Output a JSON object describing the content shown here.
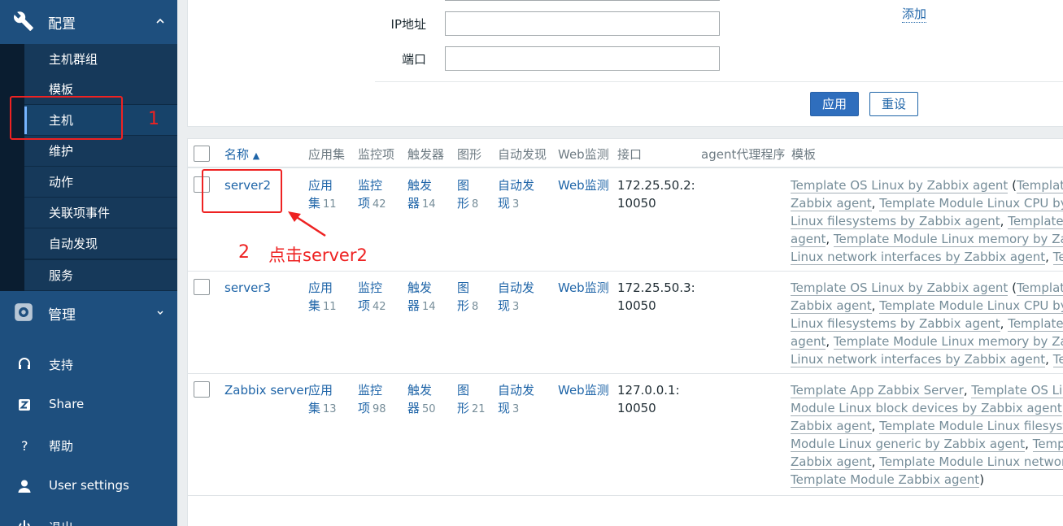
{
  "sidebar": {
    "config": {
      "label": "配置",
      "icon": "wrench-icon"
    },
    "config_items": [
      "主机群组",
      "模板",
      "主机",
      "维护",
      "动作",
      "关联项事件",
      "自动发现",
      "服务"
    ],
    "admin": {
      "label": "管理",
      "icon": "gear-icon"
    },
    "links": [
      {
        "label": "支持",
        "icon": "headset-icon"
      },
      {
        "label": "Share",
        "icon": "share-icon"
      },
      {
        "label": "帮助",
        "icon": "help-icon"
      },
      {
        "label": "User settings",
        "icon": "user-icon"
      },
      {
        "label": "退出",
        "icon": "power-icon"
      }
    ]
  },
  "filter": {
    "ip_label": "IP地址",
    "ip_value": "",
    "port_label": "端口",
    "port_value": "",
    "add_link": "添加",
    "apply": "应用",
    "reset": "重设"
  },
  "table": {
    "headers": {
      "name": "名称",
      "apps": "应用集",
      "items": "监控项",
      "triggers": "触发器",
      "graphs": "图形",
      "discovery": "自动发现",
      "web": "Web监测",
      "interface": "接口",
      "agent": "agent代理程序",
      "templates": "模板"
    },
    "rows": [
      {
        "name": "server2",
        "apps": [
          "应用",
          "集",
          "11"
        ],
        "items": [
          "监控",
          "项",
          "42"
        ],
        "triggers": [
          "触发",
          "器",
          "14"
        ],
        "graphs": [
          "图",
          "形",
          "8"
        ],
        "discovery": [
          "自动发",
          "现",
          "3"
        ],
        "web": "Web监测",
        "interface": [
          "172.25.50.2:",
          "10050"
        ],
        "templates": [
          [
            "Template OS Linux by Zabbix agent",
            " (",
            "Template Module"
          ],
          [
            "Zabbix agent",
            ", ",
            "Template Module Linux CPU by Zabbix"
          ],
          [
            "Linux filesystems by Zabbix agent",
            ", ",
            "Template Module"
          ],
          [
            "agent",
            ", ",
            "Template Module Linux memory by Zabbix agent"
          ],
          [
            "Linux network interfaces by Zabbix agent",
            ", ",
            "Template Module"
          ]
        ]
      },
      {
        "name": "server3",
        "apps": [
          "应用",
          "集",
          "11"
        ],
        "items": [
          "监控",
          "项",
          "42"
        ],
        "triggers": [
          "触发",
          "器",
          "14"
        ],
        "graphs": [
          "图",
          "形",
          "8"
        ],
        "discovery": [
          "自动发",
          "现",
          "3"
        ],
        "web": "Web监测",
        "interface": [
          "172.25.50.3:",
          "10050"
        ],
        "templates": [
          [
            "Template OS Linux by Zabbix agent",
            " (",
            "Template Module"
          ],
          [
            "Zabbix agent",
            ", ",
            "Template Module Linux CPU by Zabbix"
          ],
          [
            "Linux filesystems by Zabbix agent",
            ", ",
            "Template Module"
          ],
          [
            "agent",
            ", ",
            "Template Module Linux memory by Zabbix agent"
          ],
          [
            "Linux network interfaces by Zabbix agent",
            ", ",
            "Template Module"
          ]
        ]
      },
      {
        "name": "Zabbix server",
        "apps": [
          "应用",
          "集",
          "13"
        ],
        "items": [
          "监控",
          "项",
          "98"
        ],
        "triggers": [
          "触发",
          "器",
          "50"
        ],
        "graphs": [
          "图",
          "形",
          "21"
        ],
        "discovery": [
          "自动发",
          "现",
          "3"
        ],
        "web": "Web监测",
        "interface": [
          "127.0.0.1:",
          "10050"
        ],
        "templates": [
          [
            "Template App Zabbix Server",
            ", ",
            "Template OS Linux by"
          ],
          [
            "Module Linux block devices by Zabbix agent",
            ", ",
            "Template"
          ],
          [
            "Zabbix agent",
            ", ",
            "Template Module Linux filesystems by"
          ],
          [
            "Module Linux generic by Zabbix agent",
            ", ",
            "Template Module"
          ],
          [
            "Zabbix agent",
            ", ",
            "Template Module Linux network interfaces"
          ],
          [
            "Template Module Zabbix agent",
            ")",
            ""
          ]
        ]
      }
    ]
  },
  "annotations": {
    "step1": "1",
    "step2": "2",
    "step2_text": "点击server2",
    "color": "#ee2222"
  }
}
